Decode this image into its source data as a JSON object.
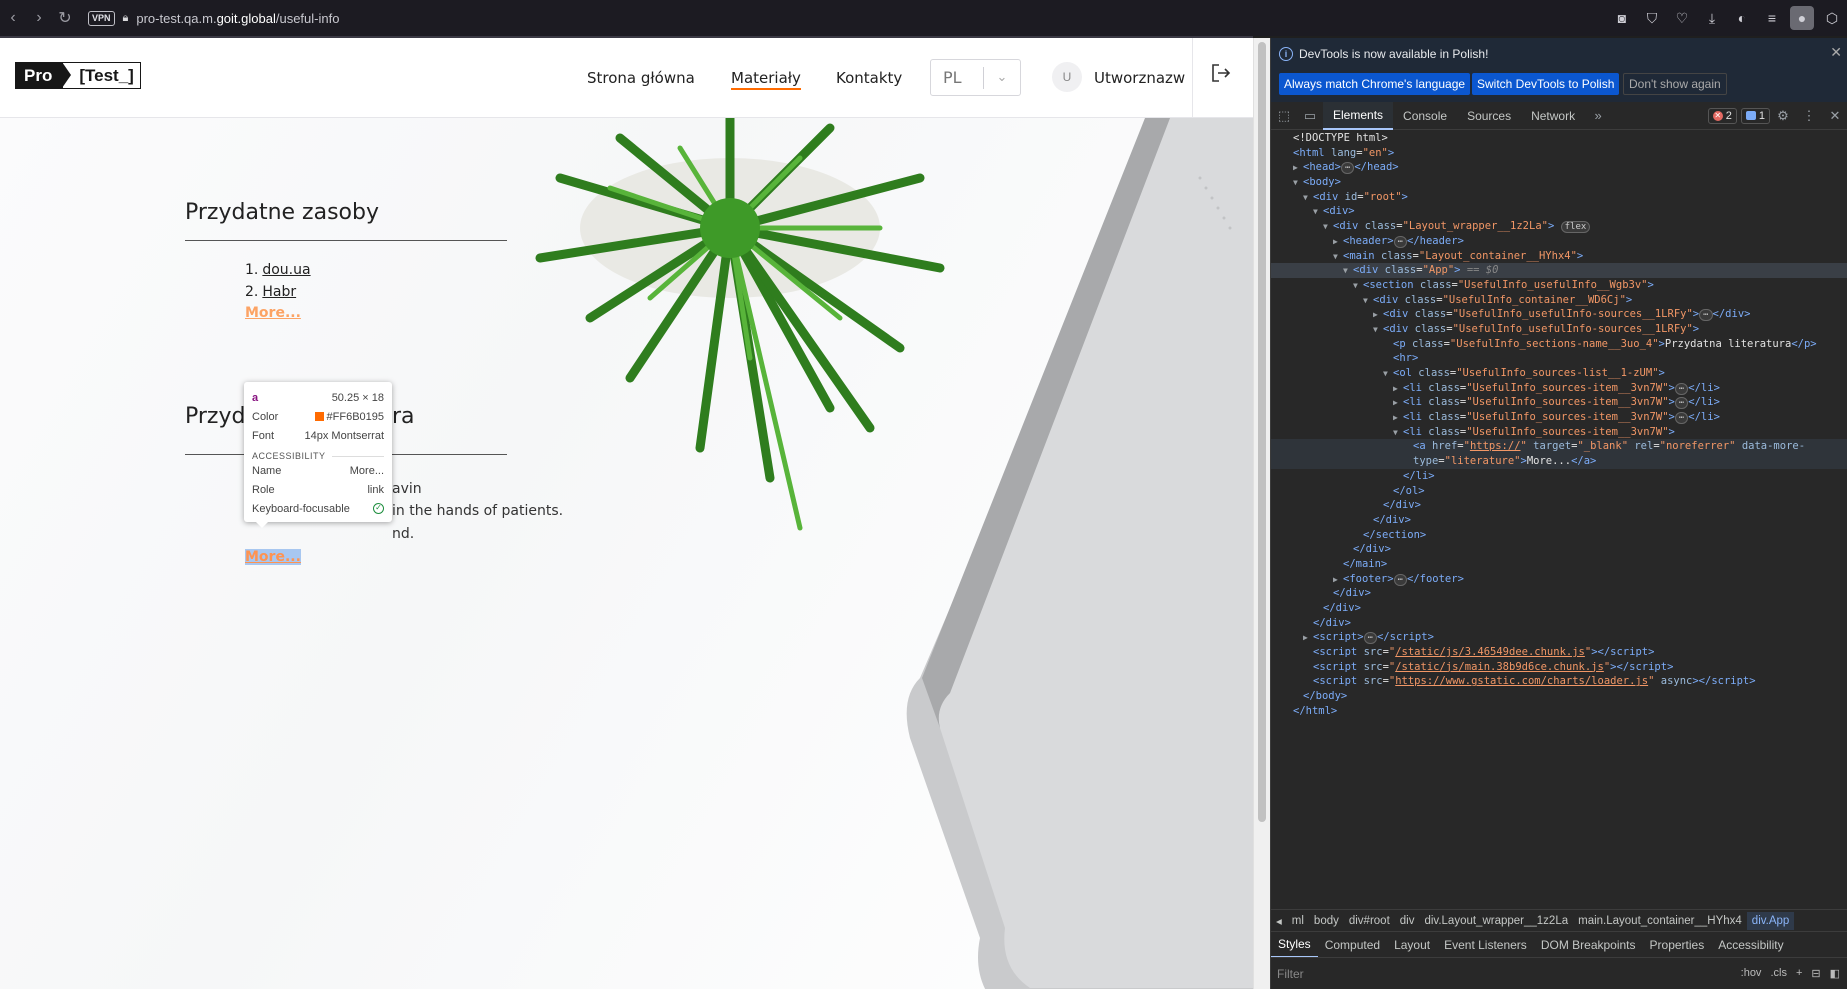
{
  "browser": {
    "url_prefix": "pro-test.qa.m.",
    "url_domain": "goit.global",
    "url_path": "/useful-info",
    "vpn_label": "VPN"
  },
  "site": {
    "logo_left": "Pro",
    "logo_right": "[Test_]",
    "nav": [
      "Strona główna",
      "Materiały",
      "Kontakty"
    ],
    "lang": "PL",
    "avatar_letter": "U",
    "username": "Utworznazw"
  },
  "content": {
    "section1_title": "Przydatne zasoby",
    "items": [
      {
        "num": "1.",
        "label": "dou.ua"
      },
      {
        "num": "2.",
        "label": "Habr"
      }
    ],
    "more": "More...",
    "section2_title_left": "Przyd",
    "section2_title_right": "ra",
    "frag1": "avin",
    "frag2": "in the hands of patients.",
    "frag3": "nd."
  },
  "tooltip": {
    "tag": "a",
    "size": "50.25 × 18",
    "color_label": "Color",
    "color_value": "#FF6B0195",
    "font_label": "Font",
    "font_value": "14px Montserrat",
    "acc_header": "ACCESSIBILITY",
    "name_label": "Name",
    "name_value": "More...",
    "role_label": "Role",
    "role_value": "link",
    "kf_label": "Keyboard-focusable",
    "accent": "#ff6b01"
  },
  "devtools": {
    "notice": "DevTools is now available in Polish!",
    "btn1": "Always match Chrome's language",
    "btn2": "Switch DevTools to Polish",
    "btn3": "Don't show again",
    "tabs": [
      "Elements",
      "Console",
      "Sources",
      "Network"
    ],
    "errors": "2",
    "messages": "1",
    "breadcrumbs": [
      "ml",
      "body",
      "div#root",
      "div",
      "div.Layout_wrapper__1z2La",
      "main.Layout_container__HYhx4",
      "div.App"
    ],
    "style_tabs": [
      "Styles",
      "Computed",
      "Layout",
      "Event Listeners",
      "DOM Breakpoints",
      "Properties",
      "Accessibility"
    ],
    "filter_placeholder": "Filter",
    "filter_hov": ":hov",
    "filter_cls": ".cls",
    "dom": [
      {
        "i": 0,
        "a": "",
        "h": "<span class='tx'>&lt;!DOCTYPE html&gt;</span>"
      },
      {
        "i": 0,
        "a": "",
        "h": "<span class='tg'>&lt;html</span> <span class='at'>lang</span>=<span class='av'>\"en\"</span><span class='tg'>&gt;</span>"
      },
      {
        "i": 1,
        "a": "▶",
        "h": "<span class='tg'>&lt;head&gt;</span><span class='pill'>⋯</span><span class='tg'>&lt;/head&gt;</span>"
      },
      {
        "i": 1,
        "a": "▼",
        "h": "<span class='tg'>&lt;body&gt;</span>"
      },
      {
        "i": 2,
        "a": "▼",
        "h": "<span class='tg'>&lt;div</span> <span class='at'>id</span>=<span class='av'>\"root\"</span><span class='tg'>&gt;</span>"
      },
      {
        "i": 3,
        "a": "▼",
        "h": "<span class='tg'>&lt;div&gt;</span>"
      },
      {
        "i": 4,
        "a": "▼",
        "h": "<span class='tg'>&lt;div</span> <span class='at'>class</span>=<span class='av'>\"Layout_wrapper__1z2La\"</span><span class='tg'>&gt;</span> <span class='pill'>flex</span>"
      },
      {
        "i": 5,
        "a": "▶",
        "h": "<span class='tg'>&lt;header&gt;</span><span class='pill'>⋯</span><span class='tg'>&lt;/header&gt;</span>"
      },
      {
        "i": 5,
        "a": "▼",
        "h": "<span class='tg'>&lt;main</span> <span class='at'>class</span>=<span class='av'>\"Layout_container__HYhx4\"</span><span class='tg'>&gt;</span>"
      },
      {
        "i": 6,
        "a": "▼",
        "sel": true,
        "h": "<span class='tg'>&lt;div</span> <span class='at'>class</span>=<span class='av'>\"App\"</span><span class='tg'>&gt;</span> <span class='eq'>== $0</span>"
      },
      {
        "i": 7,
        "a": "▼",
        "h": "<span class='tg'>&lt;section</span> <span class='at'>class</span>=<span class='av'>\"UsefulInfo_usefulInfo__Wgb3v\"</span><span class='tg'>&gt;</span>"
      },
      {
        "i": 8,
        "a": "▼",
        "h": "<span class='tg'>&lt;div</span> <span class='at'>class</span>=<span class='av'>\"UsefulInfo_container__WD6Cj\"</span><span class='tg'>&gt;</span>"
      },
      {
        "i": 9,
        "a": "▶",
        "h": "<span class='tg'>&lt;div</span> <span class='at'>class</span>=<span class='av'>\"UsefulInfo_usefulInfo-sources__1LRFy\"</span><span class='tg'>&gt;</span><span class='pill'>⋯</span><span class='tg'>&lt;/div&gt;</span>"
      },
      {
        "i": 9,
        "a": "▼",
        "h": "<span class='tg'>&lt;div</span> <span class='at'>class</span>=<span class='av'>\"UsefulInfo_usefulInfo-sources__1LRFy\"</span><span class='tg'>&gt;</span>"
      },
      {
        "i": 10,
        "a": "",
        "h": "<span class='tg'>&lt;p</span> <span class='at'>class</span>=<span class='av'>\"UsefulInfo_sections-name__3uo_4\"</span><span class='tg'>&gt;</span><span class='tx'>Przydatna literatura</span><span class='tg'>&lt;/p&gt;</span>"
      },
      {
        "i": 10,
        "a": "",
        "h": "<span class='tg'>&lt;hr&gt;</span>"
      },
      {
        "i": 10,
        "a": "▼",
        "h": "<span class='tg'>&lt;ol</span> <span class='at'>class</span>=<span class='av'>\"UsefulInfo_sources-list__1-zUM\"</span><span class='tg'>&gt;</span>"
      },
      {
        "i": 11,
        "a": "▶",
        "h": "<span class='tg'>&lt;li</span> <span class='at'>class</span>=<span class='av'>\"UsefulInfo_sources-item__3vn7W\"</span><span class='tg'>&gt;</span><span class='pill'>⋯</span><span class='tg'>&lt;/li&gt;</span>"
      },
      {
        "i": 11,
        "a": "▶",
        "h": "<span class='tg'>&lt;li</span> <span class='at'>class</span>=<span class='av'>\"UsefulInfo_sources-item__3vn7W\"</span><span class='tg'>&gt;</span><span class='pill'>⋯</span><span class='tg'>&lt;/li&gt;</span>"
      },
      {
        "i": 11,
        "a": "▶",
        "h": "<span class='tg'>&lt;li</span> <span class='at'>class</span>=<span class='av'>\"UsefulInfo_sources-item__3vn7W\"</span><span class='tg'>&gt;</span><span class='pill'>⋯</span><span class='tg'>&lt;/li&gt;</span>"
      },
      {
        "i": 11,
        "a": "▼",
        "h": "<span class='tg'>&lt;li</span> <span class='at'>class</span>=<span class='av'>\"UsefulInfo_sources-item__3vn7W\"</span><span class='tg'>&gt;</span>"
      },
      {
        "i": 12,
        "a": "",
        "hover": true,
        "h": "<span class='tg'>&lt;a</span> <span class='at'>href</span>=<span class='av'>\"<u>https://</u>\"</span> <span class='at'>target</span>=<span class='av'>\"_blank\"</span> <span class='at'>rel</span>=<span class='av'>\"noreferrer\"</span> <span class='at'>data-more-</span>"
      },
      {
        "i": 12,
        "a": "",
        "hover": true,
        "h": "<span class='at'>type</span>=<span class='av'>\"literature\"</span><span class='tg'>&gt;</span><span class='tx'>More...</span><span class='tg'>&lt;/a&gt;</span>"
      },
      {
        "i": 11,
        "a": "",
        "h": "<span class='tg'>&lt;/li&gt;</span>"
      },
      {
        "i": 10,
        "a": "",
        "h": "<span class='tg'>&lt;/ol&gt;</span>"
      },
      {
        "i": 9,
        "a": "",
        "h": "<span class='tg'>&lt;/div&gt;</span>"
      },
      {
        "i": 8,
        "a": "",
        "h": "<span class='tg'>&lt;/div&gt;</span>"
      },
      {
        "i": 7,
        "a": "",
        "h": "<span class='tg'>&lt;/section&gt;</span>"
      },
      {
        "i": 6,
        "a": "",
        "h": "<span class='tg'>&lt;/div&gt;</span>"
      },
      {
        "i": 5,
        "a": "",
        "h": "<span class='tg'>&lt;/main&gt;</span>"
      },
      {
        "i": 5,
        "a": "▶",
        "h": "<span class='tg'>&lt;footer&gt;</span><span class='pill'>⋯</span><span class='tg'>&lt;/footer&gt;</span>"
      },
      {
        "i": 4,
        "a": "",
        "h": "<span class='tg'>&lt;/div&gt;</span>"
      },
      {
        "i": 3,
        "a": "",
        "h": "<span class='tg'>&lt;/div&gt;</span>"
      },
      {
        "i": 2,
        "a": "",
        "h": "<span class='tg'>&lt;/div&gt;</span>"
      },
      {
        "i": 2,
        "a": "▶",
        "h": "<span class='tg'>&lt;script&gt;</span><span class='pill'>⋯</span><span class='tg'>&lt;/script&gt;</span>"
      },
      {
        "i": 2,
        "a": "",
        "h": "<span class='tg'>&lt;script</span> <span class='at'>src</span>=<span class='av'>\"<u>/static/js/3.46549dee.chunk.js</u>\"</span><span class='tg'>&gt;&lt;/script&gt;</span>"
      },
      {
        "i": 2,
        "a": "",
        "h": "<span class='tg'>&lt;script</span> <span class='at'>src</span>=<span class='av'>\"<u>/static/js/main.38b9d6ce.chunk.js</u>\"</span><span class='tg'>&gt;&lt;/script&gt;</span>"
      },
      {
        "i": 2,
        "a": "",
        "h": "<span class='tg'>&lt;script</span> <span class='at'>src</span>=<span class='av'>\"<u>https://www.gstatic.com/charts/loader.js</u>\"</span> <span class='at'>async</span><span class='tg'>&gt;&lt;/script&gt;</span>"
      },
      {
        "i": 1,
        "a": "",
        "h": "<span class='tg'>&lt;/body&gt;</span>"
      },
      {
        "i": 0,
        "a": "",
        "h": "<span class='tg'>&lt;/html&gt;</span>"
      }
    ]
  }
}
